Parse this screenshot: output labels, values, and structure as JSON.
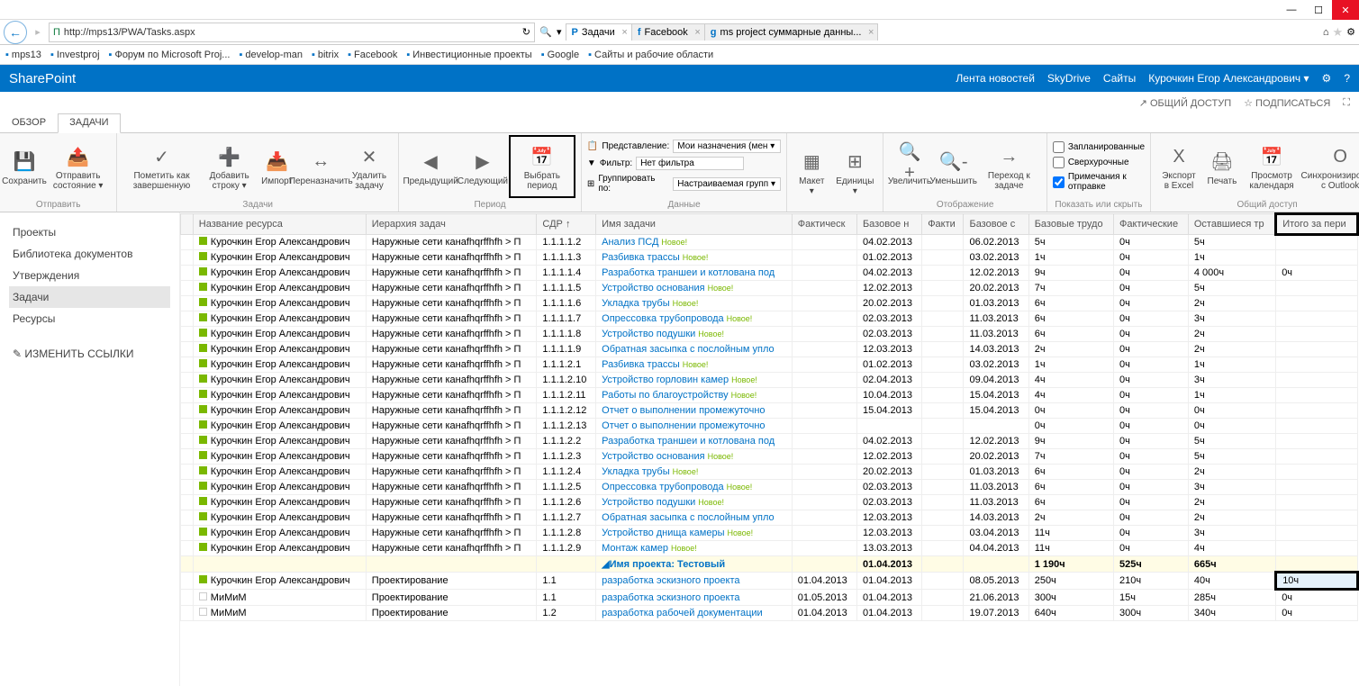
{
  "window": {
    "url": "http://mps13/PWA/Tasks.aspx"
  },
  "browserTabs": [
    {
      "label": "Задачи",
      "active": true,
      "icon": "P"
    },
    {
      "label": "Facebook",
      "active": false,
      "icon": "f"
    },
    {
      "label": "ms project суммарные данны...",
      "active": false,
      "icon": "g"
    }
  ],
  "favorites": [
    {
      "label": "mps13"
    },
    {
      "label": "Investproj"
    },
    {
      "label": "Форум по Microsoft Proj..."
    },
    {
      "label": "develop-man"
    },
    {
      "label": "bitrix"
    },
    {
      "label": "Facebook"
    },
    {
      "label": "Инвестиционные проекты"
    },
    {
      "label": "Google"
    },
    {
      "label": "Сайты и рабочие области"
    }
  ],
  "sp": {
    "title": "SharePoint",
    "nav": [
      "Лента новостей",
      "SkyDrive",
      "Сайты"
    ],
    "user": "Курочкин Егор Александрович"
  },
  "subbar": {
    "share": "ОБЩИЙ ДОСТУП",
    "follow": "ПОДПИСАТЬСЯ"
  },
  "msTabs": [
    {
      "label": "ОБЗОР"
    },
    {
      "label": "ЗАДАЧИ",
      "active": true
    }
  ],
  "ribbon": {
    "groups": [
      {
        "label": "Отправить",
        "btns": [
          {
            "l": "Сохранить",
            "i": "💾"
          },
          {
            "l": "Отправить состояние ▾",
            "i": "📤"
          }
        ]
      },
      {
        "label": "Задачи",
        "btns": [
          {
            "l": "Пометить как завершенную",
            "i": "✓"
          },
          {
            "l": "Добавить строку ▾",
            "i": "➕"
          },
          {
            "l": "Импорт",
            "i": "📥"
          },
          {
            "l": "Переназначить",
            "i": "↔"
          },
          {
            "l": "Удалить задачу",
            "i": "✕"
          }
        ]
      },
      {
        "label": "Период",
        "btns": [
          {
            "l": "Предыдущий",
            "i": "◀"
          },
          {
            "l": "Следующий",
            "i": "▶"
          },
          {
            "l": "Выбрать период",
            "i": "📅",
            "hl": true
          }
        ]
      },
      {
        "label": "Данные",
        "rows": true,
        "view_l": "Представление:",
        "view_v": "Мои назначения (мен ▾",
        "filter_l": "Фильтр:",
        "filter_v": "Нет фильтра",
        "group_l": "Группировать по:",
        "group_v": "Настраиваемая групп ▾"
      },
      {
        "label": "",
        "btns": [
          {
            "l": "Макет ▾",
            "i": "▦"
          },
          {
            "l": "Единицы ▾",
            "i": "⊞"
          }
        ]
      },
      {
        "label": "Отображение",
        "btns": [
          {
            "l": "Увеличить",
            "i": "🔍+"
          },
          {
            "l": "Уменьшить",
            "i": "🔍-"
          },
          {
            "l": "Переход к задаче",
            "i": "→"
          }
        ]
      },
      {
        "label": "Показать или скрыть",
        "checks": [
          {
            "l": "Запланированные",
            "c": false
          },
          {
            "l": "Сверхурочные",
            "c": false
          },
          {
            "l": "Примечания к отправке",
            "c": true
          }
        ]
      },
      {
        "label": "Общий доступ",
        "btns": [
          {
            "l": "Экспорт в Excel",
            "i": "X"
          },
          {
            "l": "Печать",
            "i": "🖨"
          },
          {
            "l": "Просмотр календаря",
            "i": "📅"
          },
          {
            "l": "Синхронизировать с Outlook",
            "i": "O"
          }
        ]
      }
    ]
  },
  "leftnav": [
    {
      "l": "Проекты"
    },
    {
      "l": "Библиотека документов"
    },
    {
      "l": "Утверждения"
    },
    {
      "l": "Задачи",
      "active": true
    },
    {
      "l": "Ресурсы"
    },
    {
      "l": "✎ ИЗМЕНИТЬ ССЫЛКИ",
      "edit": true
    }
  ],
  "columns": [
    "Название ресурса",
    "Иерархия задач",
    "СДР ↑",
    "Имя задачи",
    "Фактическ",
    "Базовое н",
    "Факти",
    "Базовое с",
    "Базовые трудо",
    "Фактические",
    "Оставшиеся тр",
    "Итого за пери"
  ],
  "rows": [
    {
      "r": "Курочкин Егор Александрович",
      "h": "Наружные сети канаfhqrffhfh > П",
      "w": "1.1.1.1.2",
      "t": "Анализ ПСД",
      "new": 1,
      "bn": "04.02.2013",
      "be": "06.02.2013",
      "bt": "5ч",
      "ft": "0ч",
      "rt": "5ч"
    },
    {
      "r": "Курочкин Егор Александрович",
      "h": "Наружные сети канаfhqrffhfh > П",
      "w": "1.1.1.1.3",
      "t": "Разбивка трассы",
      "new": 1,
      "bn": "01.02.2013",
      "be": "03.02.2013",
      "bt": "1ч",
      "ft": "0ч",
      "rt": "1ч"
    },
    {
      "r": "Курочкин Егор Александрович",
      "h": "Наружные сети канаfhqrffhfh > П",
      "w": "1.1.1.1.4",
      "t": "Разработка траншеи и котлована под",
      "bn": "04.02.2013",
      "be": "12.02.2013",
      "bt": "9ч",
      "ft": "0ч",
      "rt": "4 000ч",
      "tot": "0ч"
    },
    {
      "r": "Курочкин Егор Александрович",
      "h": "Наружные сети канаfhqrffhfh > П",
      "w": "1.1.1.1.5",
      "t": "Устройство основания",
      "new": 1,
      "bn": "12.02.2013",
      "be": "20.02.2013",
      "bt": "7ч",
      "ft": "0ч",
      "rt": "5ч"
    },
    {
      "r": "Курочкин Егор Александрович",
      "h": "Наружные сети канаfhqrffhfh > П",
      "w": "1.1.1.1.6",
      "t": "Укладка трубы",
      "new": 1,
      "bn": "20.02.2013",
      "be": "01.03.2013",
      "bt": "6ч",
      "ft": "0ч",
      "rt": "2ч"
    },
    {
      "r": "Курочкин Егор Александрович",
      "h": "Наружные сети канаfhqrffhfh > П",
      "w": "1.1.1.1.7",
      "t": "Опрессовка трубопровода",
      "new": 1,
      "bn": "02.03.2013",
      "be": "11.03.2013",
      "bt": "6ч",
      "ft": "0ч",
      "rt": "3ч"
    },
    {
      "r": "Курочкин Егор Александрович",
      "h": "Наружные сети канаfhqrffhfh > П",
      "w": "1.1.1.1.8",
      "t": "Устройство подушки",
      "new": 1,
      "bn": "02.03.2013",
      "be": "11.03.2013",
      "bt": "6ч",
      "ft": "0ч",
      "rt": "2ч"
    },
    {
      "r": "Курочкин Егор Александрович",
      "h": "Наружные сети канаfhqrffhfh > П",
      "w": "1.1.1.1.9",
      "t": "Обратная засыпка с послойным упло",
      "bn": "12.03.2013",
      "be": "14.03.2013",
      "bt": "2ч",
      "ft": "0ч",
      "rt": "2ч"
    },
    {
      "r": "Курочкин Егор Александрович",
      "h": "Наружные сети канаfhqrffhfh > П",
      "w": "1.1.1.2.1",
      "t": "Разбивка трассы",
      "new": 1,
      "bn": "01.02.2013",
      "be": "03.02.2013",
      "bt": "1ч",
      "ft": "0ч",
      "rt": "1ч"
    },
    {
      "r": "Курочкин Егор Александрович",
      "h": "Наружные сети канаfhqrffhfh > П",
      "w": "1.1.1.2.10",
      "t": "Устройство горловин камер",
      "new": 1,
      "bn": "02.04.2013",
      "be": "09.04.2013",
      "bt": "4ч",
      "ft": "0ч",
      "rt": "3ч"
    },
    {
      "r": "Курочкин Егор Александрович",
      "h": "Наружные сети канаfhqrffhfh > П",
      "w": "1.1.1.2.11",
      "t": "Работы по благоустройству",
      "new": 1,
      "bn": "10.04.2013",
      "be": "15.04.2013",
      "bt": "4ч",
      "ft": "0ч",
      "rt": "1ч"
    },
    {
      "r": "Курочкин Егор Александрович",
      "h": "Наружные сети канаfhqrffhfh > П",
      "w": "1.1.1.2.12",
      "t": "Отчет о выполнении промежуточно",
      "bn": "15.04.2013",
      "be": "15.04.2013",
      "bt": "0ч",
      "ft": "0ч",
      "rt": "0ч"
    },
    {
      "r": "Курочкин Егор Александрович",
      "h": "Наружные сети канаfhqrffhfh > П",
      "w": "1.1.1.2.13",
      "t": "Отчет о выполнении промежуточно",
      "bn": "",
      "be": "",
      "bt": "0ч",
      "ft": "0ч",
      "rt": "0ч"
    },
    {
      "r": "Курочкин Егор Александрович",
      "h": "Наружные сети канаfhqrffhfh > П",
      "w": "1.1.1.2.2",
      "t": "Разработка траншеи и котлована под",
      "bn": "04.02.2013",
      "be": "12.02.2013",
      "bt": "9ч",
      "ft": "0ч",
      "rt": "5ч"
    },
    {
      "r": "Курочкин Егор Александрович",
      "h": "Наружные сети канаfhqrffhfh > П",
      "w": "1.1.1.2.3",
      "t": "Устройство основания",
      "new": 1,
      "bn": "12.02.2013",
      "be": "20.02.2013",
      "bt": "7ч",
      "ft": "0ч",
      "rt": "5ч"
    },
    {
      "r": "Курочкин Егор Александрович",
      "h": "Наружные сети канаfhqrffhfh > П",
      "w": "1.1.1.2.4",
      "t": "Укладка трубы",
      "new": 1,
      "bn": "20.02.2013",
      "be": "01.03.2013",
      "bt": "6ч",
      "ft": "0ч",
      "rt": "2ч"
    },
    {
      "r": "Курочкин Егор Александрович",
      "h": "Наружные сети канаfhqrffhfh > П",
      "w": "1.1.1.2.5",
      "t": "Опрессовка трубопровода",
      "new": 1,
      "bn": "02.03.2013",
      "be": "11.03.2013",
      "bt": "6ч",
      "ft": "0ч",
      "rt": "3ч"
    },
    {
      "r": "Курочкин Егор Александрович",
      "h": "Наружные сети канаfhqrffhfh > П",
      "w": "1.1.1.2.6",
      "t": "Устройство подушки",
      "new": 1,
      "bn": "02.03.2013",
      "be": "11.03.2013",
      "bt": "6ч",
      "ft": "0ч",
      "rt": "2ч"
    },
    {
      "r": "Курочкин Егор Александрович",
      "h": "Наружные сети канаfhqrffhfh > П",
      "w": "1.1.1.2.7",
      "t": "Обратная засыпка с послойным упло",
      "bn": "12.03.2013",
      "be": "14.03.2013",
      "bt": "2ч",
      "ft": "0ч",
      "rt": "2ч"
    },
    {
      "r": "Курочкин Егор Александрович",
      "h": "Наружные сети канаfhqrffhfh > П",
      "w": "1.1.1.2.8",
      "t": "Устройство днища камеры",
      "new": 1,
      "bn": "12.03.2013",
      "be": "03.04.2013",
      "bt": "11ч",
      "ft": "0ч",
      "rt": "3ч"
    },
    {
      "r": "Курочкин Егор Александрович",
      "h": "Наружные сети канаfhqrffhfh > П",
      "w": "1.1.1.2.9",
      "t": "Монтаж камер",
      "new": 1,
      "bn": "13.03.2013",
      "be": "04.04.2013",
      "bt": "11ч",
      "ft": "0ч",
      "rt": "4ч"
    }
  ],
  "summary": {
    "t": "◢Имя проекта: Тестовый",
    "bn": "01.04.2013",
    "bt": "1 190ч",
    "ft": "525ч",
    "rt": "665ч"
  },
  "rows2": [
    {
      "r": "Курочкин Егор Александрович",
      "h": "Проектирование",
      "w": "1.1",
      "t": "разработка эскизного проекта",
      "fs": "01.04.2013",
      "bn": "01.04.2013",
      "be": "08.05.2013",
      "bt": "250ч",
      "ft": "210ч",
      "rt": "40ч",
      "tot": "10ч",
      "hl": true,
      "sq": 1
    },
    {
      "r": "МиМиМ",
      "h": "Проектирование",
      "w": "1.1",
      "t": "разработка эскизного проекта",
      "fs": "01.05.2013",
      "bn": "01.04.2013",
      "be": "21.06.2013",
      "bt": "300ч",
      "ft": "15ч",
      "rt": "285ч",
      "tot": "0ч",
      "sq": 0
    },
    {
      "r": "МиМиМ",
      "h": "Проектирование",
      "w": "1.2",
      "t": "разработка рабочей документации",
      "fs": "01.04.2013",
      "bn": "01.04.2013",
      "be": "19.07.2013",
      "bt": "640ч",
      "ft": "300ч",
      "rt": "340ч",
      "tot": "0ч",
      "sq": 0
    }
  ]
}
